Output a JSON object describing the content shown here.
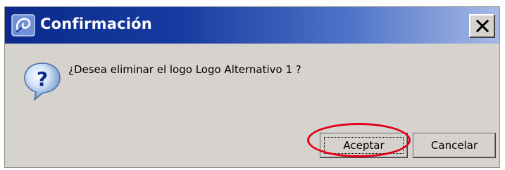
{
  "dialog": {
    "title": "Confirmación",
    "message": "¿Desea eliminar el logo Logo Alternativo 1 ?",
    "buttons": {
      "accept_label": "Aceptar",
      "cancel_label": "Cancelar"
    },
    "close_label": "X"
  },
  "icons": {
    "app": "app-logo-icon",
    "question": "question-mark-icon",
    "close": "close-icon"
  },
  "colors": {
    "titlebar_start": "#0b2a8c",
    "titlebar_end": "#a7b9e6",
    "dialog_background": "#d6d3ce",
    "highlight": "#e0001a"
  }
}
